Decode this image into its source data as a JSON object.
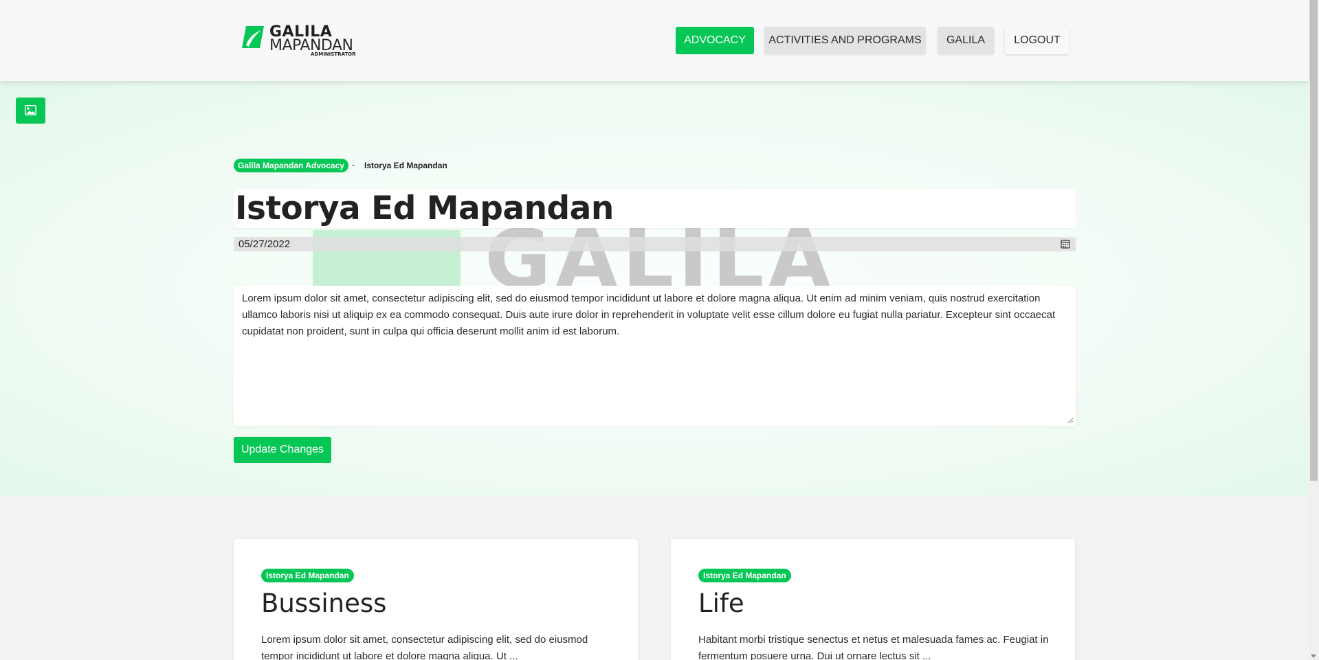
{
  "header": {
    "logo": {
      "line1": "GALILA",
      "line2": "MAPANDAN",
      "line3": "ADMINISTRATOR"
    },
    "nav": {
      "advocacy": "ADVOCACY",
      "activities": "ACTIVITIES AND PROGRAMS",
      "galila": "GALILA",
      "logout": "LOGOUT"
    }
  },
  "hero": {
    "watermark_text": "GALILA",
    "breadcrumb": {
      "parent": "Galila Mapandan Advocacy",
      "separator": "-",
      "current": "Istorya Ed Mapandan"
    },
    "title_value": "Istorya Ed Mapandan",
    "date_value": "05/27/2022",
    "description_value": "Lorem ipsum dolor sit amet, consectetur adipiscing elit, sed do eiusmod tempor incididunt ut labore et dolore magna aliqua. Ut enim ad minim veniam, quis nostrud exercitation ullamco laboris nisi ut aliquip ex ea commodo consequat. Duis aute irure dolor in reprehenderit in voluptate velit esse cillum dolore eu fugiat nulla pariatur. Excepteur sint occaecat cupidatat non proident, sunt in culpa qui officia deserunt mollit anim id est laborum.",
    "update_button": "Update Changes"
  },
  "cards": [
    {
      "badge": "Istorya Ed Mapandan",
      "title": "Bussiness",
      "excerpt": "Lorem ipsum dolor sit amet, consectetur adipiscing elit, sed do eiusmod tempor incididunt ut labore et dolore magna aliqua. Ut ..."
    },
    {
      "badge": "Istorya Ed Mapandan",
      "title": "Life",
      "excerpt": "Habitant morbi tristique senectus et netus et malesuada fames ac. Feugiat in fermentum posuere urna. Dui ut ornare lectus sit ..."
    }
  ],
  "colors": {
    "accent": "#06c755",
    "header_bg": "#f7f8fa",
    "page_bg": "#f2f2f2"
  },
  "icons": {
    "image_button": "image-icon",
    "date_picker": "calendar-icon"
  }
}
